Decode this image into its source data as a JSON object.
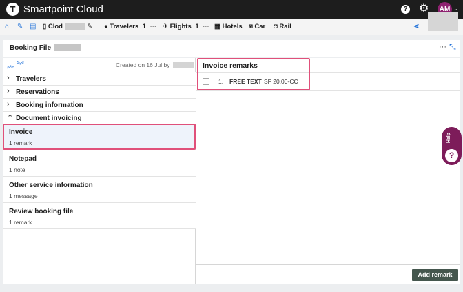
{
  "app": {
    "title": "Smartpoint Cloud",
    "logo_letter": "T"
  },
  "topbar": {
    "help_icon": "question-circle-icon",
    "settings_icon": "gear-icon",
    "avatar_initials": "AM"
  },
  "nav": {
    "pnr_label": "Clod",
    "travelers_label": "Travelers",
    "travelers_count": "1",
    "flights_label": "Flights",
    "flights_count": "1",
    "hotels_label": "Hotels",
    "car_label": "Car",
    "rail_label": "Rail",
    "more": "···"
  },
  "booking": {
    "title": "Booking File",
    "created_label": "Created on 16 Jul by",
    "more": "···"
  },
  "sections": [
    {
      "label": "Travelers",
      "state": "collapsed"
    },
    {
      "label": "Reservations",
      "state": "collapsed"
    },
    {
      "label": "Booking information",
      "state": "collapsed"
    },
    {
      "label": "Document invoicing",
      "state": "expanded"
    }
  ],
  "items": [
    {
      "title": "Invoice",
      "subtitle": "1 remark",
      "selected": true
    },
    {
      "title": "Notepad",
      "subtitle": "1 note",
      "selected": false
    },
    {
      "title": "Other service information",
      "subtitle": "1 message",
      "selected": false
    },
    {
      "title": "Review booking file",
      "subtitle": "1 remark",
      "selected": false
    }
  ],
  "remarks": {
    "title": "Invoice remarks",
    "rows": [
      {
        "number": "1.",
        "type": "FREE TEXT",
        "text": "SF 20.00-CC"
      }
    ],
    "add_button": "Add remark"
  },
  "help_widget": {
    "label": "Help",
    "icon": "?"
  },
  "colors": {
    "accent_blue": "#1d6fd8",
    "highlight": "#e0507a",
    "brand_purple": "#8e2170",
    "button_green": "#44564d"
  }
}
